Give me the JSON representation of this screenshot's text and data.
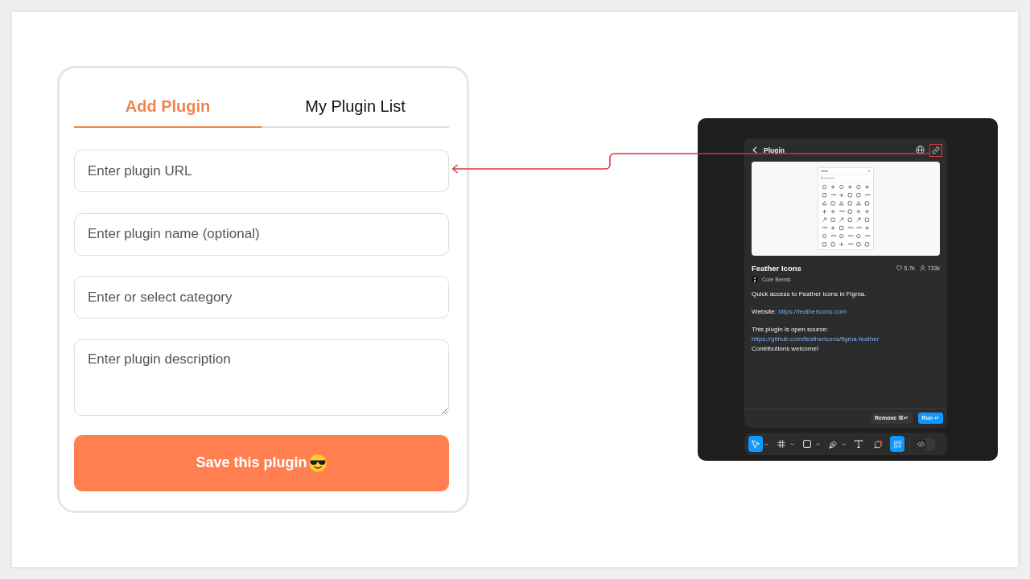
{
  "plugin_form": {
    "tabs": [
      {
        "label": "Add Plugin",
        "selected": true
      },
      {
        "label": "My Plugin List",
        "selected": false
      }
    ],
    "fields": [
      {
        "kind": "input",
        "placeholder": "Enter plugin URL"
      },
      {
        "kind": "input",
        "placeholder": "Enter plugin name (optional)"
      },
      {
        "kind": "input",
        "placeholder": "Enter or select category"
      },
      {
        "kind": "textarea",
        "placeholder": "Enter plugin description"
      }
    ],
    "save_button": {
      "label": "Save this plugin"
    }
  },
  "plugin_window": {
    "header": {
      "title": "Plugin"
    },
    "plugin": {
      "name": "Feather Icons",
      "likes": "5.7k",
      "users": "733k",
      "author": "Cole Bemis"
    },
    "description": [
      {
        "lines": [
          {
            "text": "Quick access to Feather icons in Figma."
          }
        ]
      },
      {
        "lines": [
          {
            "text": "Website: ",
            "link": "https://feathericons.com"
          }
        ]
      },
      {
        "lines": [
          {
            "text": "This plugin is open source: ",
            "link": "https://github.com/feathericons/figma-feather"
          },
          {
            "text": "Contributions welcome!"
          }
        ]
      }
    ],
    "actions": [
      {
        "kind": "secondary",
        "label": "Remove ⌘↵"
      },
      {
        "kind": "primary",
        "label": "Run ↵"
      }
    ]
  },
  "toolbar": {
    "tools": [
      {
        "kind": "move",
        "selected": true,
        "menu": true
      },
      {
        "kind": "frame",
        "selected": false,
        "menu": true
      },
      {
        "kind": "shape",
        "selected": false,
        "menu": true
      },
      {
        "kind": "pen",
        "selected": false,
        "menu": true
      },
      {
        "kind": "text",
        "selected": false,
        "menu": false
      },
      {
        "kind": "comment",
        "selected": false,
        "menu": false
      },
      {
        "kind": "actions",
        "selected": true,
        "menu": false
      }
    ],
    "dev_mode": {
      "on": false
    }
  }
}
